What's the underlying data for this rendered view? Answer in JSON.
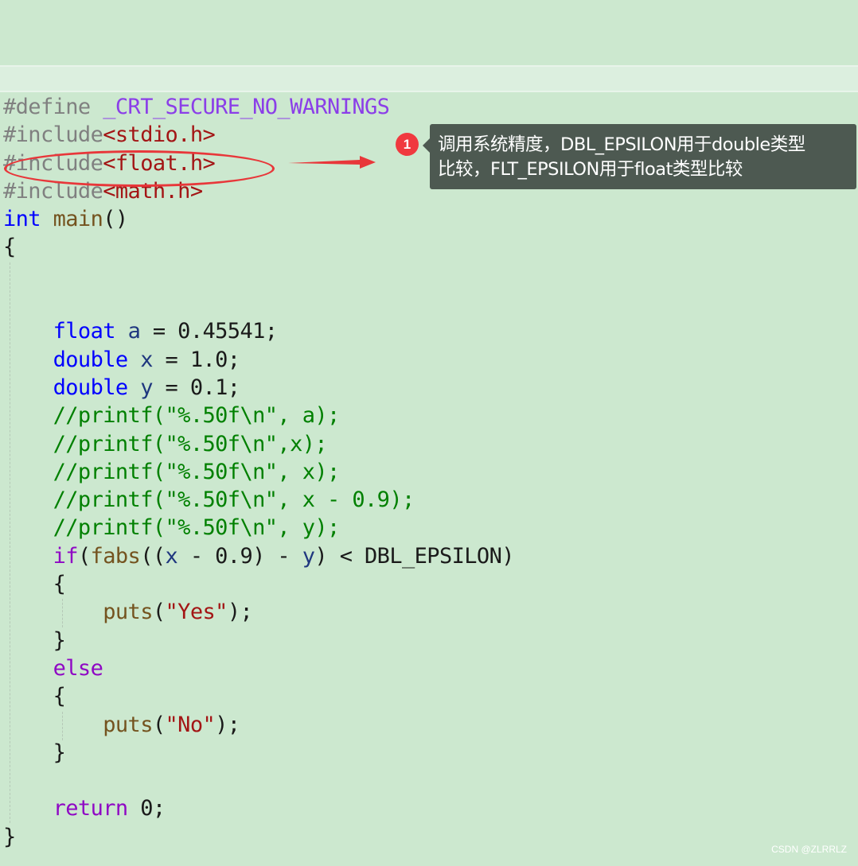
{
  "code_lines": [
    [
      {
        "c": "pp",
        "t": "#define "
      },
      {
        "c": "macro",
        "t": "_CRT_SECURE_NO_WARNINGS"
      }
    ],
    [
      {
        "c": "pp",
        "t": "#include"
      },
      {
        "c": "hdr",
        "t": "<stdio.h>"
      }
    ],
    [
      {
        "c": "pp",
        "t": "#include"
      },
      {
        "c": "hdr",
        "t": "<float.h>"
      }
    ],
    [
      {
        "c": "pp",
        "t": "#include"
      },
      {
        "c": "hdr",
        "t": "<math.h>"
      }
    ],
    [
      {
        "c": "kw",
        "t": "int"
      },
      {
        "c": "",
        "t": " "
      },
      {
        "c": "fn",
        "t": "main"
      },
      {
        "c": "",
        "t": "()"
      }
    ],
    [
      {
        "c": "",
        "t": "{"
      }
    ],
    [],
    [],
    [
      {
        "c": "",
        "t": "    "
      },
      {
        "c": "kw",
        "t": "float"
      },
      {
        "c": "",
        "t": " "
      },
      {
        "c": "var",
        "t": "a"
      },
      {
        "c": "",
        "t": " = 0.45541;"
      }
    ],
    [
      {
        "c": "",
        "t": "    "
      },
      {
        "c": "kw",
        "t": "double"
      },
      {
        "c": "",
        "t": " "
      },
      {
        "c": "var",
        "t": "x"
      },
      {
        "c": "",
        "t": " = 1.0;"
      }
    ],
    [
      {
        "c": "",
        "t": "    "
      },
      {
        "c": "kw",
        "t": "double"
      },
      {
        "c": "",
        "t": " "
      },
      {
        "c": "var",
        "t": "y"
      },
      {
        "c": "",
        "t": " = 0.1;"
      }
    ],
    [
      {
        "c": "",
        "t": "    "
      },
      {
        "c": "cm",
        "t": "//printf(\"%.50f\\n\", a);"
      }
    ],
    [
      {
        "c": "",
        "t": "    "
      },
      {
        "c": "cm",
        "t": "//printf(\"%.50f\\n\",x);"
      }
    ],
    [
      {
        "c": "",
        "t": "    "
      },
      {
        "c": "cm",
        "t": "//printf(\"%.50f\\n\", x);"
      }
    ],
    [
      {
        "c": "",
        "t": "    "
      },
      {
        "c": "cm",
        "t": "//printf(\"%.50f\\n\", x - 0.9);"
      }
    ],
    [
      {
        "c": "",
        "t": "    "
      },
      {
        "c": "cm",
        "t": "//printf(\"%.50f\\n\", y);"
      }
    ],
    [
      {
        "c": "",
        "t": "    "
      },
      {
        "c": "ctl",
        "t": "if"
      },
      {
        "c": "",
        "t": "("
      },
      {
        "c": "fn",
        "t": "fabs"
      },
      {
        "c": "",
        "t": "(("
      },
      {
        "c": "var",
        "t": "x"
      },
      {
        "c": "",
        "t": " - 0.9) - "
      },
      {
        "c": "var",
        "t": "y"
      },
      {
        "c": "",
        "t": ") < DBL_EPSILON)"
      }
    ],
    [
      {
        "c": "",
        "t": "    {"
      }
    ],
    [
      {
        "c": "",
        "t": "        "
      },
      {
        "c": "fn",
        "t": "puts"
      },
      {
        "c": "",
        "t": "("
      },
      {
        "c": "str",
        "t": "\"Yes\""
      },
      {
        "c": "",
        "t": ");"
      }
    ],
    [
      {
        "c": "",
        "t": "    }"
      }
    ],
    [
      {
        "c": "",
        "t": "    "
      },
      {
        "c": "ctl",
        "t": "else"
      }
    ],
    [
      {
        "c": "",
        "t": "    {"
      }
    ],
    [
      {
        "c": "",
        "t": "        "
      },
      {
        "c": "fn",
        "t": "puts"
      },
      {
        "c": "",
        "t": "("
      },
      {
        "c": "str",
        "t": "\"No\""
      },
      {
        "c": "",
        "t": ");"
      }
    ],
    [
      {
        "c": "",
        "t": "    }"
      }
    ],
    [],
    [
      {
        "c": "",
        "t": "    "
      },
      {
        "c": "ctl",
        "t": "return"
      },
      {
        "c": "",
        "t": " 0;"
      }
    ],
    [
      {
        "c": "",
        "t": "}"
      }
    ]
  ],
  "annotation": {
    "badge_number": "1",
    "tooltip_line1": "调用系统精度，DBL_EPSILON用于double类型",
    "tooltip_line2": "比较，FLT_EPSILON用于float类型比较"
  },
  "watermark": "CSDN @ZLRRLZ",
  "colors": {
    "background": "#cce8cf",
    "tooltip_bg": "#4d5951",
    "highlight_red": "#e8373a"
  }
}
